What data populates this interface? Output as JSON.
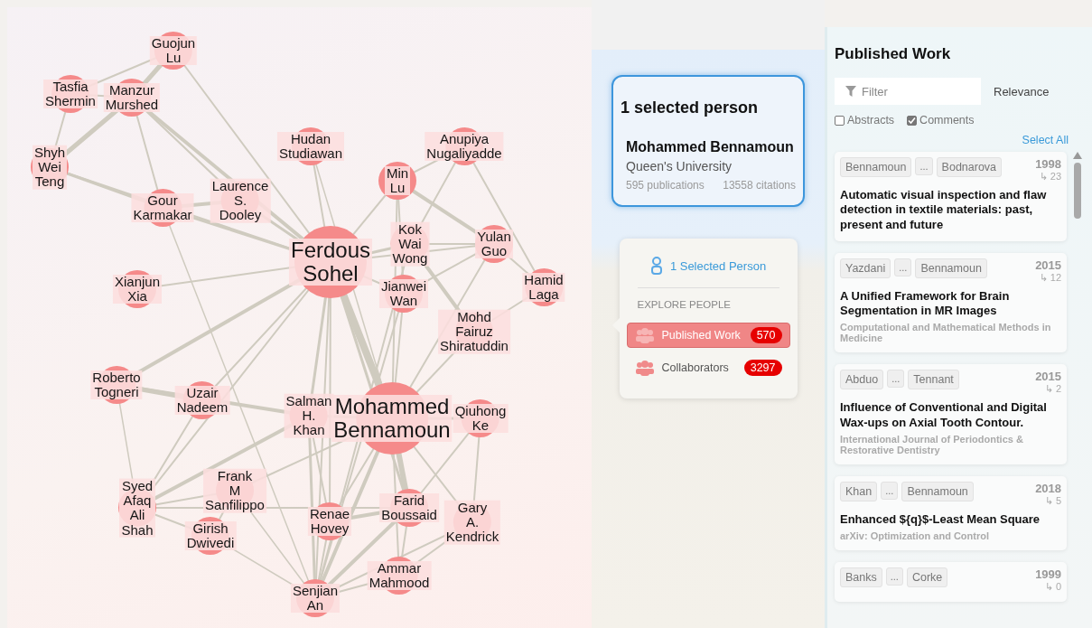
{
  "graph": {
    "nodes": [
      {
        "lines": [
          "Guojun",
          "Lu"
        ],
        "kind": "minor"
      },
      {
        "lines": [
          "Tasfia",
          "Shermin"
        ],
        "kind": "minor"
      },
      {
        "lines": [
          "Manzur",
          "Murshed"
        ],
        "kind": "minor"
      },
      {
        "lines": [
          "Shyh",
          "Wei",
          "Teng"
        ],
        "kind": "minor"
      },
      {
        "lines": [
          "Gour",
          "Karmakar"
        ],
        "kind": "minor"
      },
      {
        "lines": [
          "Laurence",
          "S.",
          "Dooley"
        ],
        "kind": "minor"
      },
      {
        "lines": [
          "Hudan",
          "Studiawan"
        ],
        "kind": "minor"
      },
      {
        "lines": [
          "Ferdous",
          "Sohel"
        ],
        "kind": "major"
      },
      {
        "lines": [
          "Xianjun",
          "Xia"
        ],
        "kind": "minor"
      },
      {
        "lines": [
          "Anupiya",
          "Nugaliyadde"
        ],
        "kind": "minor"
      },
      {
        "lines": [
          "Min",
          "Lu"
        ],
        "kind": "minor"
      },
      {
        "lines": [
          "Kok",
          "Wai",
          "Wong"
        ],
        "kind": "minor"
      },
      {
        "lines": [
          "Yulan",
          "Guo"
        ],
        "kind": "minor"
      },
      {
        "lines": [
          "Jianwei",
          "Wan"
        ],
        "kind": "minor"
      },
      {
        "lines": [
          "Hamid",
          "Laga"
        ],
        "kind": "minor"
      },
      {
        "lines": [
          "Mohd",
          "Fairuz",
          "Shiratuddin"
        ],
        "kind": "minor"
      },
      {
        "lines": [
          "Roberto",
          "Togneri"
        ],
        "kind": "minor"
      },
      {
        "lines": [
          "Uzair",
          "Nadeem"
        ],
        "kind": "minor"
      },
      {
        "lines": [
          "Salman",
          "H.",
          "Khan"
        ],
        "kind": "minor"
      },
      {
        "lines": [
          "Mohammed",
          "Bennamoun"
        ],
        "kind": "major"
      },
      {
        "lines": [
          "Qiuhong",
          "Ke"
        ],
        "kind": "minor"
      },
      {
        "lines": [
          "Syed",
          "Afaq",
          "Ali",
          "Shah"
        ],
        "kind": "minor"
      },
      {
        "lines": [
          "Frank",
          "M",
          "Sanfilippo"
        ],
        "kind": "minor"
      },
      {
        "lines": [
          "Girish",
          "Dwivedi"
        ],
        "kind": "minor"
      },
      {
        "lines": [
          "Renae",
          "Hovey"
        ],
        "kind": "minor"
      },
      {
        "lines": [
          "Farid",
          "Boussaid"
        ],
        "kind": "minor"
      },
      {
        "lines": [
          "Gary",
          "A.",
          "Kendrick"
        ],
        "kind": "minor"
      },
      {
        "lines": [
          "Ammar",
          "Mahmood"
        ],
        "kind": "minor"
      },
      {
        "lines": [
          "Senjian",
          "An"
        ],
        "kind": "minor"
      }
    ]
  },
  "selection": {
    "heading": "1 selected person",
    "name": "Mohammed Bennamoun",
    "affiliation": "Queen's University",
    "publications": "595 publications",
    "citations": "13558 citations"
  },
  "explore": {
    "selected_link": "1 Selected Person",
    "section": "EXPLORE PEOPLE",
    "items": [
      {
        "label": "Published Work",
        "count": "570",
        "selected": true
      },
      {
        "label": "Collaborators",
        "count": "3297",
        "selected": false
      }
    ]
  },
  "published_work": {
    "title": "Published Work",
    "filter": {
      "placeholder": "Filter"
    },
    "sort": "Relevance",
    "options": [
      {
        "label": "Abstracts",
        "checked": false
      },
      {
        "label": "Comments",
        "checked": true
      }
    ],
    "select_all": "Select All",
    "papers": [
      {
        "first_author": "Bennamoun",
        "more": "...",
        "last_author": "Bodnarova",
        "year": "1998",
        "citations": "↳ 23",
        "title": "Automatic visual inspection and flaw detection in textile materials: past, present and future"
      },
      {
        "first_author": "Yazdani",
        "more": "...",
        "last_author": "Bennamoun",
        "year": "2015",
        "citations": "↳ 12",
        "title": "A Unified Framework for Brain Segmentation in MR Images",
        "venue": "Computational and Mathematical Methods in Medicine"
      },
      {
        "first_author": "Abduo",
        "more": "...",
        "last_author": "Tennant",
        "year": "2015",
        "citations": "↳ 2",
        "title": "Influence of Conventional and Digital Wax-ups on Axial Tooth Contour.",
        "venue": "International Journal of Periodontics & Restorative Dentistry"
      },
      {
        "first_author": "Khan",
        "more": "...",
        "last_author": "Bennamoun",
        "year": "2018",
        "citations": "↳ 5",
        "title": "Enhanced ${q}$-Least Mean Square",
        "venue": "arXiv: Optimization and Control"
      },
      {
        "first_author": "Banks",
        "more": "...",
        "last_author": "Corke",
        "year": "1999",
        "citations": "↳ 0"
      }
    ]
  }
}
